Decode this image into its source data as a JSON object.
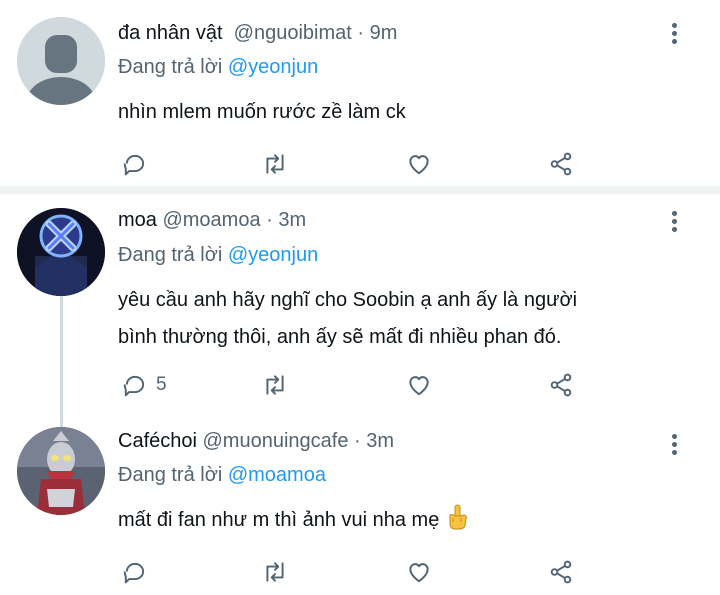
{
  "tweets": [
    {
      "display_name": "đa nhân vật",
      "handle": "@nguoibimat",
      "time": "· 9m",
      "reply_prefix": "Đang trả lời",
      "reply_to": "@yeonjun",
      "text_lines": [
        "nhìn mlem muốn rước zề làm ck"
      ],
      "reply_count": ""
    },
    {
      "display_name": "moa",
      "handle": "@moamoa",
      "time": "· 3m",
      "reply_prefix": "Đang trả lời",
      "reply_to": "@yeonjun",
      "text_lines": [
        "yêu cầu anh hãy nghĩ cho Soobin ạ anh ấy là người",
        "bình thường thôi, anh ấy sẽ mất đi nhiều phan đó."
      ],
      "reply_count": "5"
    },
    {
      "display_name": "Caféchoi",
      "handle": "@muonuingcafe",
      "time": "· 3m",
      "reply_prefix": "Đang trả lời",
      "reply_to": "@moamoa",
      "text_lines": [
        "mất đi fan như m thì ảnh vui nha mẹ"
      ],
      "reply_count": ""
    }
  ],
  "icons": {
    "reply": "reply-icon",
    "retweet": "retweet-icon",
    "like": "heart-icon",
    "share": "share-icon",
    "more": "more-vertical-icon",
    "emoji": "middle-finger-emoji"
  },
  "colors": {
    "mention": "#1d9bf0",
    "secondary_text": "#536471",
    "divider": "#eff3f4"
  }
}
